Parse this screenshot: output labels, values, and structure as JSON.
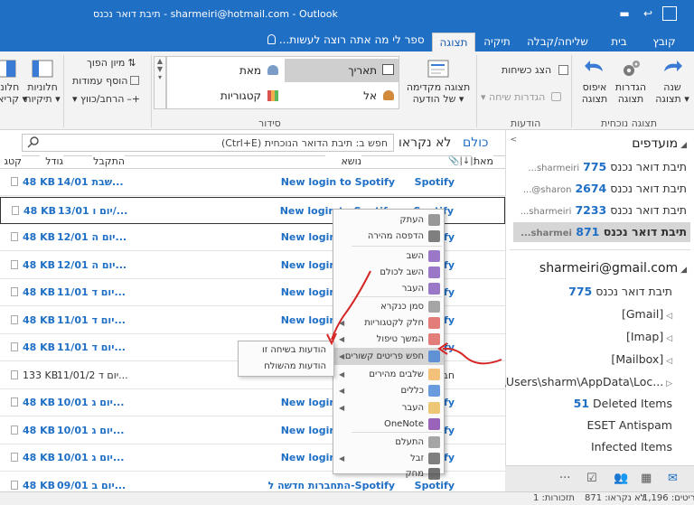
{
  "window": {
    "title": "תיבת דואר נכנס - sharmeiri@hotmail.com - Outlook"
  },
  "tabs": [
    {
      "label": "קובץ"
    },
    {
      "label": "בית"
    },
    {
      "label": "שליחה/קבלה"
    },
    {
      "label": "תיקיה"
    },
    {
      "label": "תצוגה"
    }
  ],
  "tell_me": "ספר לי מה אתה רוצה לעשות...",
  "ribbon": {
    "change_view": "שנה\nתצוגה ▾",
    "view_settings": "הגדרות\nתצוגה",
    "reset_view": "איפוס\nתצוגה",
    "group_current_view": "תצוגה נוכחית",
    "show_conversations": "הצג כשיחות",
    "conversation_settings": "הגדרות שיחה ▾",
    "group_messages": "הודעות",
    "message_preview": "תצוגה מקדימה\nשל הודעה ▾",
    "arrange": {
      "date": "תאריך",
      "from": "מאת",
      "to": "אל",
      "categories": "קטגוריות"
    },
    "reverse_sort": "מיון הפוך",
    "add_columns": "הוסף עמודות",
    "expand_collapse": "הרחב/כווץ ▾",
    "group_arrangement": "סידור",
    "reading_pane": "חלונית\nקריאה ▾",
    "folder_pane": "חלוניות\nתיקיות ▾"
  },
  "folders": {
    "favorites_header": "מועדפים",
    "favorites": [
      {
        "name": "תיבת דואר נכנס",
        "count": "775",
        "account": "sharmeiri..."
      },
      {
        "name": "תיבת דואר נכנס",
        "count": "2674",
        "account": "sharon@..."
      },
      {
        "name": "תיבת דואר נכנס",
        "count": "7233",
        "account": "sharmeiri..."
      },
      {
        "name": "תיבת דואר נכנס",
        "count": "871",
        "account": "sharmei..."
      }
    ],
    "account": "sharmeiri@gmail.com",
    "account_folders": [
      {
        "name": "תיבת דואר נכנס",
        "count": "775"
      },
      {
        "name": "[Gmail]",
        "count": ""
      },
      {
        "name": "[Imap]",
        "count": ""
      },
      {
        "name": "[Mailbox]",
        "count": ""
      },
      {
        "name": "C:\\Users\\sharm\\AppData\\Loc...",
        "count": ""
      },
      {
        "name": "Deleted Items",
        "count": "51"
      },
      {
        "name": "ESET Antispam",
        "count": ""
      },
      {
        "name": "Infected Items",
        "count": ""
      }
    ]
  },
  "list": {
    "filter_all": "כולם",
    "filter_unread": "לא נקראו",
    "search_placeholder": "חפש ב: תיבת הדואר הנוכחית (Ctrl+E)",
    "columns": {
      "from": "מאת",
      "subject": "נושא",
      "received": "התקבל",
      "size": "גודל",
      "category": "קטג"
    },
    "rows": [
      {
        "from": "Spotify",
        "subject": "New login to Spotify",
        "received": "שבת 14/01...",
        "size": "48 KB"
      },
      {
        "from": "Spotify",
        "subject": "New login to Spotify",
        "received": "יום ו 13/01/...",
        "size": "48 KB"
      },
      {
        "from": "Spotify",
        "subject": "New login to Spotify",
        "received": "יום ה 12/01...",
        "size": "48 KB"
      },
      {
        "from": "Spotify",
        "subject": "New login to Spotify",
        "received": "יום ה 12/01...",
        "size": "48 KB"
      },
      {
        "from": "Spotify",
        "subject": "New login to Spotify",
        "received": "יום ד 11/01...",
        "size": "48 KB"
      },
      {
        "from": "Spotify",
        "subject": "New login to Spotify",
        "received": "יום ד 11/01...",
        "size": "48 KB"
      },
      {
        "from": "Spotify",
        "subject": "New login to Spotify",
        "received": "יום ד 11/01...",
        "size": "48 KB"
      },
      {
        "from": "חברת",
        "subject": "",
        "received": "יום ד 11/01/2...",
        "size": "133 KB"
      },
      {
        "from": "Spotify",
        "subject": "New login to Spotify",
        "received": "יום ג 10/01...",
        "size": "48 KB"
      },
      {
        "from": "Spotify",
        "subject": "New login to Spotify",
        "received": "יום ג 10/01...",
        "size": "48 KB"
      },
      {
        "from": "Spotify",
        "subject": "New login to Spotify",
        "received": "יום ג 10/01...",
        "size": "48 KB"
      },
      {
        "from": "Spotify",
        "subject": "התחברות חדשה ל-Spotify",
        "received": "יום ב 09/01...",
        "size": "48 KB"
      }
    ]
  },
  "context_menu": {
    "items": [
      {
        "label": "העתק",
        "icon": "copy-icon",
        "submenu": false
      },
      {
        "label": "הדפסה מהירה",
        "icon": "print-icon",
        "submenu": false
      },
      {
        "label": "השב",
        "icon": "reply-icon",
        "submenu": false
      },
      {
        "label": "השב לכולם",
        "icon": "reply-all-icon",
        "submenu": false
      },
      {
        "label": "העבר",
        "icon": "forward-icon",
        "submenu": false
      },
      {
        "label": "סמן כנקרא",
        "icon": "mark-read-icon",
        "submenu": false
      },
      {
        "label": "חלק לקטגוריות",
        "icon": "categorize-icon",
        "submenu": true
      },
      {
        "label": "המשך טיפול",
        "icon": "flag-icon",
        "submenu": true
      },
      {
        "label": "חפש פריטים קשורים",
        "icon": "find-related-icon",
        "submenu": true
      },
      {
        "label": "שלבים מהירים",
        "icon": "quick-steps-icon",
        "submenu": true
      },
      {
        "label": "כללים",
        "icon": "rules-icon",
        "submenu": true
      },
      {
        "label": "העבר",
        "icon": "move-icon",
        "submenu": true
      },
      {
        "label": "OneNote",
        "icon": "onenote-icon",
        "submenu": false
      },
      {
        "label": "התעלם",
        "icon": "ignore-icon",
        "submenu": false
      },
      {
        "label": "זבל",
        "icon": "junk-icon",
        "submenu": true
      },
      {
        "label": "מחק",
        "icon": "delete-icon",
        "submenu": false
      }
    ],
    "submenu": [
      {
        "label": "הודעות בשיחה זו"
      },
      {
        "label": "הודעות מהשולח"
      }
    ]
  },
  "status": {
    "items": "פריטים: 1,196",
    "unread": "לא נקראו: 871",
    "reminders": "תזכורות: 1"
  },
  "colors": {
    "accent": "#1f6fc5",
    "annotation": "#d62626"
  }
}
